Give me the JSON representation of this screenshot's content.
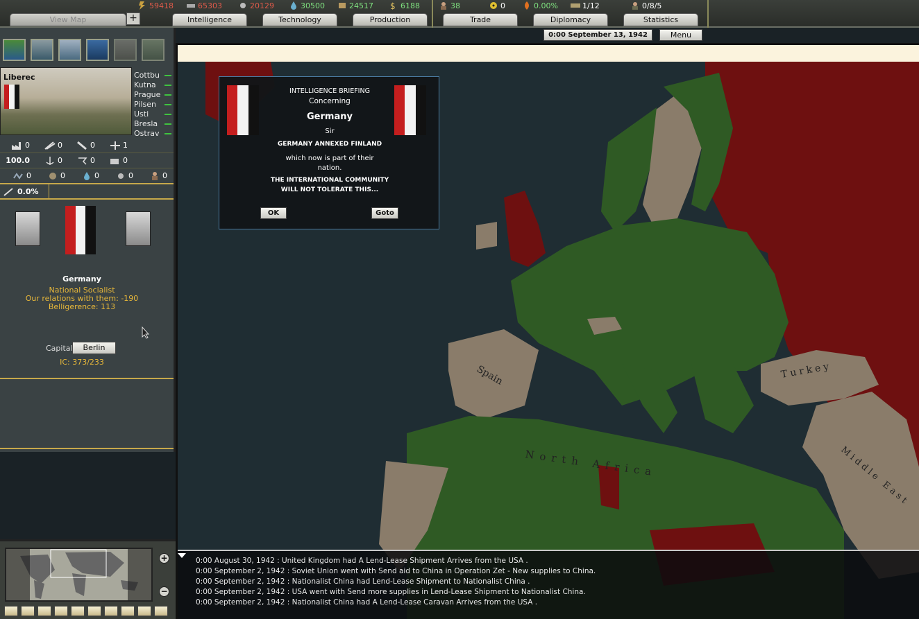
{
  "resources": [
    {
      "icon": "energy-icon",
      "value": "59418",
      "color": "red"
    },
    {
      "icon": "metal-icon",
      "value": "65303",
      "color": "red"
    },
    {
      "icon": "rare-materials-icon",
      "value": "20129",
      "color": "red"
    },
    {
      "icon": "oil-icon",
      "value": "30500",
      "color": "green"
    },
    {
      "icon": "supplies-icon",
      "value": "24517",
      "color": "green"
    },
    {
      "icon": "money-icon",
      "value": "6188",
      "color": "green"
    },
    {
      "icon": "manpower-icon",
      "value": "38",
      "color": "green"
    },
    {
      "icon": "nuclear-icon",
      "value": "0",
      "color": "white"
    },
    {
      "icon": "dissent-icon",
      "value": "0.00%",
      "color": "green"
    },
    {
      "icon": "transports-icon",
      "value": "1/12",
      "color": "white"
    },
    {
      "icon": "officers-icon",
      "value": "0/8/5",
      "color": "white"
    }
  ],
  "tabs": {
    "view_map": "View Map",
    "intelligence": "Intelligence",
    "technology": "Technology",
    "production": "Production",
    "trade": "Trade",
    "diplomacy": "Diplomacy",
    "statistics": "Statistics"
  },
  "plus_label": "+",
  "date": "0:00 September 13, 1942",
  "menu_label": "Menu",
  "map_mode_buttons": [
    "terrain-map-icon",
    "army-map-icon",
    "air-map-icon",
    "naval-map-icon",
    "leader-map-icon",
    "supply-map-icon"
  ],
  "province": {
    "name": "Liberec",
    "nearby": [
      "Cottbu",
      "Kutna",
      "Prague",
      "Pilsen",
      "Usti",
      "Bresla",
      "Ostrav"
    ],
    "stats_row1": [
      {
        "icon": "factory-icon",
        "value": "0"
      },
      {
        "icon": "anti-air-icon",
        "value": "0"
      },
      {
        "icon": "coastal-fort-icon",
        "value": "0"
      },
      {
        "icon": "airfield-icon",
        "value": "1"
      }
    ],
    "stats_row2": [
      {
        "icon": "railway-icon",
        "value": "100.0"
      },
      {
        "icon": "naval-base-icon",
        "value": "0"
      },
      {
        "icon": "radar-icon",
        "value": "0"
      },
      {
        "icon": "nuclear-reactor-icon",
        "value": "0"
      }
    ],
    "stats_row3": [
      {
        "icon": "infrastructure-icon",
        "value": "0"
      },
      {
        "icon": "energy-res-icon",
        "value": "0"
      },
      {
        "icon": "oil-res-icon",
        "value": "0"
      },
      {
        "icon": "rare-res-icon",
        "value": "0"
      },
      {
        "icon": "manpower-res-icon",
        "value": "0"
      }
    ],
    "resistance": "0.0%"
  },
  "country": {
    "name": "Germany",
    "ideology": "National Socialist",
    "relations": "Our relations with them: -190",
    "belligerence": "Belligerence: 113",
    "capital_label": "Capital:",
    "capital": "Berlin",
    "ic": "IC: 373/233"
  },
  "dialog": {
    "header": "INTELLIGENCE BRIEFING",
    "concerning": "Concerning",
    "country": "Germany",
    "sir": "Sir",
    "headline": "GERMANY ANNEXED FINLAND",
    "body": "which now is part of their nation.",
    "warning_line1": "THE INTERNATIONAL COMMUNITY",
    "warning_line2": "WILL NOT TOLERATE THIS...",
    "ok": "OK",
    "goto": "Goto"
  },
  "map_labels": [
    "Spain",
    "North Africa",
    "Turkey",
    "Middle East"
  ],
  "log": [
    "0:00 August 30, 1942 : United Kingdom had A Lend-Lease Shipment Arrives from the USA .",
    "0:00 September 2, 1942 : Soviet Union went with Send aid to China in Operation Zet - New supplies to China.",
    "0:00 September 2, 1942 : Nationalist China had Lend-Lease Shipment to Nationalist China .",
    "0:00 September 2, 1942 : USA went with Send more supplies in Lend-Lease Shipment to Nationalist China.",
    "0:00 September 2, 1942 : Nationalist China had A Lend-Lease Caravan Arrives from the USA ."
  ],
  "colors": {
    "axis_green": "#2f5a24",
    "allies_red": "#6e1010",
    "neutral_tan": "#8a7c6a",
    "ocean": "#1f2d33",
    "accent_gold": "#c7a84a",
    "flag_red": "#c41e1e"
  }
}
